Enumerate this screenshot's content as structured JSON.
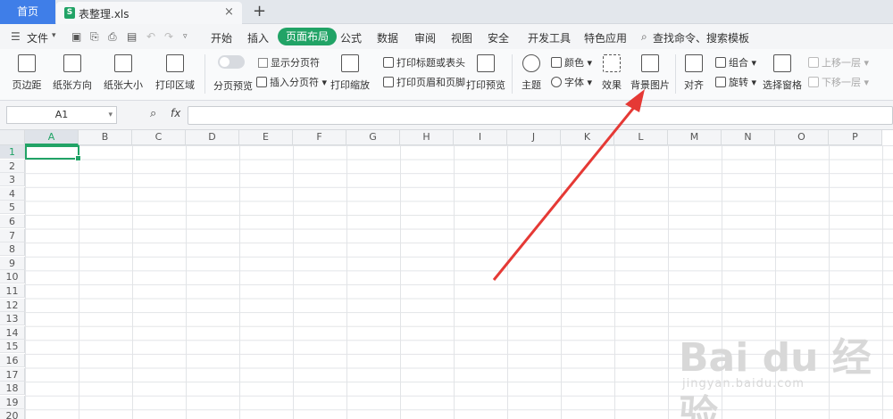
{
  "tabs": {
    "home_label": "首页",
    "file_name": "表整理.xls",
    "close_glyph": "×",
    "add_glyph": "+"
  },
  "menu": {
    "file_label": "文件",
    "items": [
      "开始",
      "插入",
      "页面布局",
      "公式",
      "数据",
      "审阅",
      "视图",
      "安全",
      "开发工具",
      "特色应用"
    ],
    "active_index": 2,
    "search_label": "查找命令、搜索模板"
  },
  "ribbon": {
    "margins": "页边距",
    "orientation": "纸张方向",
    "paper_size": "纸张大小",
    "print_area": "打印区域",
    "page_break_preview": "分页预览",
    "show_page_break": "显示分页符",
    "insert_page_break": "插入分页符",
    "print_scaling": "打印缩放",
    "print_titles": "打印标题或表头",
    "print_header_footer": "打印页眉和页脚",
    "print_preview": "打印预览",
    "theme": "主题",
    "colors": "颜色",
    "fonts": "字体",
    "effects": "效果",
    "background_image": "背景图片",
    "align": "对齐",
    "group": "组合",
    "rotate": "旋转",
    "selection_pane": "选择窗格",
    "bring_forward": "上移一层",
    "send_backward": "下移一层"
  },
  "formula_bar": {
    "name_box": "A1",
    "fx_label": "fx",
    "value": ""
  },
  "grid": {
    "columns": [
      "A",
      "B",
      "C",
      "D",
      "E",
      "F",
      "G",
      "H",
      "I",
      "J",
      "K",
      "L",
      "M",
      "N",
      "O",
      "P"
    ],
    "rows": [
      "1",
      "2",
      "3",
      "4",
      "5",
      "6",
      "7",
      "8",
      "9",
      "10",
      "11",
      "12",
      "13",
      "14",
      "15",
      "16",
      "17",
      "18",
      "19",
      "20"
    ],
    "active_cell": "A1"
  },
  "watermark": {
    "brand": "Bai du 经验",
    "url": "jingyan.baidu.com"
  },
  "colors": {
    "accent_green": "#21a366",
    "home_tab_blue": "#3f7ee8",
    "annotation_red": "#e53935"
  }
}
